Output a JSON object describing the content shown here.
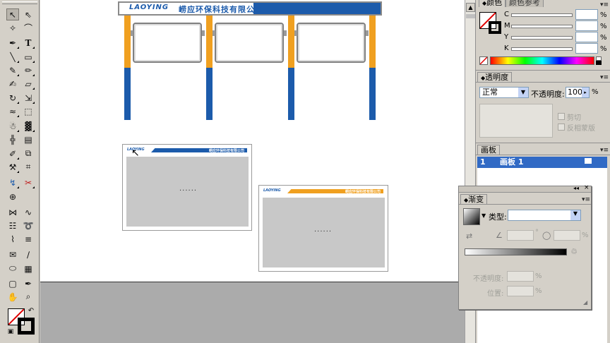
{
  "colors": {
    "orange": "#f0a020",
    "blue": "#1c5bab",
    "selection_blue": "#316ac5",
    "board_gray": "#c8c8c8"
  },
  "billboard": {
    "logo": "LAOYING",
    "company": "崂应环保科技有限公司"
  },
  "small_board_1": {
    "logo": "LAOYING",
    "company": "崂应环保科技有限公司",
    "placeholder": "......"
  },
  "small_board_2": {
    "logo": "LAOYING",
    "company": "崂应环保科技有限公司",
    "placeholder": "......"
  },
  "color_panel": {
    "tab_active": "颜色",
    "tab_inactive": "颜色参考",
    "channels": [
      {
        "label": "C",
        "value": "",
        "unit": "%"
      },
      {
        "label": "M",
        "value": "",
        "unit": "%"
      },
      {
        "label": "Y",
        "value": "",
        "unit": "%"
      },
      {
        "label": "K",
        "value": "",
        "unit": "%"
      }
    ]
  },
  "transparency_panel": {
    "title": "透明度",
    "blend_mode": "正常",
    "opacity_label": "不透明度:",
    "opacity_value": "100",
    "unit": "%",
    "clip_label": "剪切",
    "invert_mask_label": "反相蒙版"
  },
  "artboards_panel": {
    "title": "画板",
    "rows": [
      {
        "index": "1",
        "name": "画板 1"
      }
    ]
  },
  "gradient_panel": {
    "title": "渐变",
    "type_label": "类型:",
    "type_value": "",
    "angle_unit": "°",
    "aspect_unit": "%",
    "opacity_label": "不透明度:",
    "opacity_unit": "%",
    "location_label": "位置:",
    "location_unit": "%"
  }
}
